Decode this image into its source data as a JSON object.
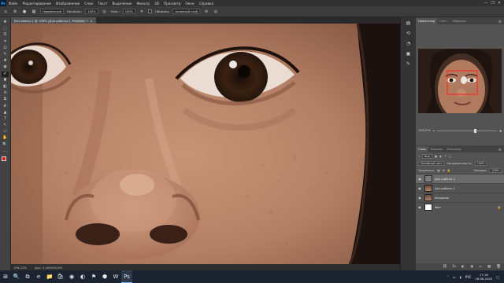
{
  "app": {
    "name": "Ps",
    "accent": "#31a8ff"
  },
  "menu": [
    "Файл",
    "Редактирование",
    "Изображение",
    "Слои",
    "Текст",
    "Выделение",
    "Фильтр",
    "3D",
    "Просмотр",
    "Окно",
    "Справка"
  ],
  "window_controls": [
    "—",
    "❐",
    "✕"
  ],
  "options": {
    "mode_label": "Нормальный",
    "opacity_label": "Непрозр.:",
    "opacity_value": "100%",
    "flow_label": "Наж.:",
    "flow_value": "100%",
    "sample_label": "Образец:",
    "sample_value": "Активный слой"
  },
  "document_tab": {
    "title": "Без имени-1 @ 199% (Для работы 2, RGB/8#) *",
    "close": "×"
  },
  "status": {
    "zoom": "199,22%",
    "doc": "Док: 3,40М/36,0М"
  },
  "navigator": {
    "tabs": [
      "Навигатор",
      "Гист.",
      "Образцы"
    ],
    "menu": "≡",
    "zoom": "199,22%"
  },
  "layers": {
    "tabs": [
      "Слои",
      "Каналы",
      "Контуры"
    ],
    "menu": "≡",
    "kind": "Вид",
    "blend": "Линейный свет",
    "opacity_label": "Непрозрачность:",
    "opacity_value": "100%",
    "lock_label": "Закрепить:",
    "fill_label": "Заливка:",
    "fill_value": "100%",
    "items": [
      {
        "name": "Для работы 2",
        "thumb": "gray",
        "selected": true
      },
      {
        "name": "Для работы 1",
        "thumb": "face",
        "selected": false
      },
      {
        "name": "Исходник",
        "thumb": "face",
        "selected": false
      },
      {
        "name": "Фон",
        "thumb": "white",
        "selected": false
      }
    ],
    "footer_icons": [
      "⛓",
      "fx",
      "◐",
      "◑",
      "▭",
      "▦",
      "🗑"
    ]
  },
  "tools": [
    "✥",
    "⬚",
    "ʘ",
    "⌗",
    "⊡",
    "✎",
    "✚",
    "◉",
    "✐",
    "⬮",
    "◧",
    "⊘",
    "⧉",
    "◭",
    "▲",
    "T",
    "↖",
    "▭",
    "✋",
    "🔍",
    "…"
  ],
  "dock_icons": [
    "▤",
    "⟲",
    "◔",
    "▣",
    "✎"
  ],
  "taskbar": {
    "icons": [
      "⊞",
      "🔍",
      "⧉",
      "e",
      "📁",
      "🛍",
      "◉",
      "◐",
      "⚑",
      "⬢",
      "W",
      "Ps"
    ],
    "active_index": 11,
    "tray": {
      "lang": "РУС",
      "time": "17:16",
      "date": "16.08.2020"
    }
  }
}
